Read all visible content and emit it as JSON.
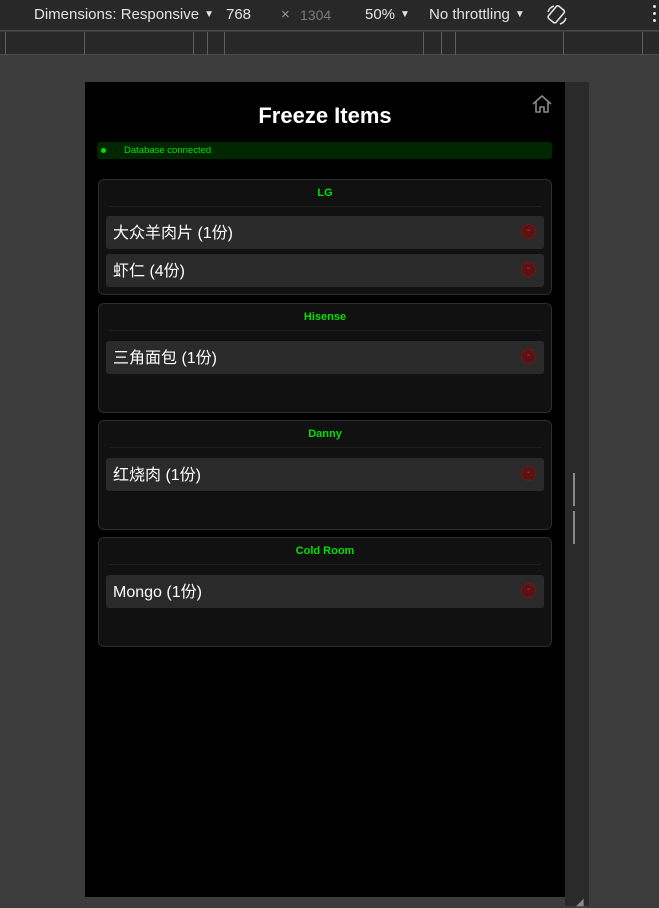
{
  "devtools": {
    "dimensions_label": "Dimensions: Responsive",
    "width": "768",
    "times": "×",
    "height": "1304",
    "zoom": "50%",
    "throttling": "No throttling",
    "caret": "▼"
  },
  "app": {
    "title": "Freeze Items",
    "status": "Database connected",
    "remove_label": "-"
  },
  "groups": [
    {
      "name": "LG",
      "items": [
        "大众羊肉片 (1份)",
        "虾仁 (4份)"
      ]
    },
    {
      "name": "Hisense",
      "items": [
        "三角面包 (1份)"
      ]
    },
    {
      "name": "Danny",
      "items": [
        "红烧肉 (1份)"
      ]
    },
    {
      "name": "Cold Room",
      "items": [
        "Mongo (1份)"
      ]
    }
  ],
  "colors": {
    "accent_green": "#00e000",
    "background": "#000000",
    "card": "#111111",
    "item": "#2a2a2a",
    "remove": "#5a1212"
  }
}
